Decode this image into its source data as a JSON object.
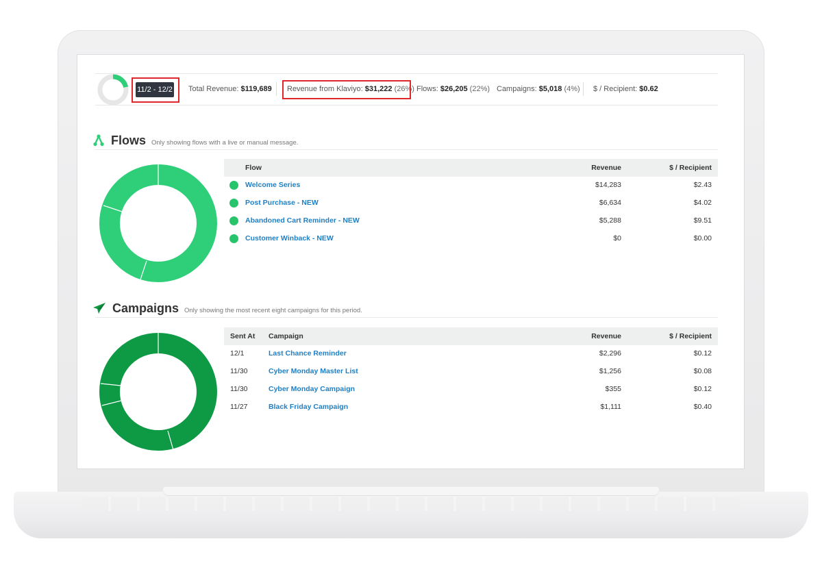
{
  "summary": {
    "date_range": "11/2 - 12/2",
    "total_revenue_label": "Total Revenue:",
    "total_revenue_value": "$119,689",
    "klaviyo_label": "Revenue from Klaviyo:",
    "klaviyo_value": "$31,222",
    "klaviyo_pct": "(26%)",
    "flows_label": "Flows:",
    "flows_value": "$26,205",
    "flows_pct": "(22%)",
    "campaigns_label": "Campaigns:",
    "campaigns_value": "$5,018",
    "campaigns_pct": "(4%)",
    "per_recipient_label": "$ / Recipient:",
    "per_recipient_value": "$0.62"
  },
  "flows": {
    "title": "Flows",
    "note": "Only showing flows with a live or manual message.",
    "col_flow": "Flow",
    "col_revenue": "Revenue",
    "col_per_recipient": "$ / Recipient",
    "rows": [
      {
        "name": "Welcome Series",
        "revenue": "$14,283",
        "per_recipient": "$2.43"
      },
      {
        "name": "Post Purchase - NEW",
        "revenue": "$6,634",
        "per_recipient": "$4.02"
      },
      {
        "name": "Abandoned Cart Reminder - NEW",
        "revenue": "$5,288",
        "per_recipient": "$9.51"
      },
      {
        "name": "Customer Winback - NEW",
        "revenue": "$0",
        "per_recipient": "$0.00"
      }
    ]
  },
  "campaigns": {
    "title": "Campaigns",
    "note": "Only showing the most recent eight campaigns for this period.",
    "col_sent_at": "Sent At",
    "col_campaign": "Campaign",
    "col_revenue": "Revenue",
    "col_per_recipient": "$ / Recipient",
    "rows": [
      {
        "sent_at": "12/1",
        "name": "Last Chance Reminder",
        "revenue": "$2,296",
        "per_recipient": "$0.12"
      },
      {
        "sent_at": "11/30",
        "name": "Cyber Monday Master List",
        "revenue": "$1,256",
        "per_recipient": "$0.08"
      },
      {
        "sent_at": "11/30",
        "name": "Cyber Monday Campaign",
        "revenue": "$355",
        "per_recipient": "$0.12"
      },
      {
        "sent_at": "11/27",
        "name": "Black Friday Campaign",
        "revenue": "$1,111",
        "per_recipient": "$0.40"
      }
    ]
  },
  "colors": {
    "flows_green": "#2ecf78",
    "campaigns_green": "#0e9a44",
    "link_blue": "#1f7fc3",
    "highlight_red": "#e0262b",
    "pill_dark": "#2f3640"
  },
  "icons": {
    "flows": "flows-network-icon",
    "campaigns": "paper-plane-icon"
  }
}
